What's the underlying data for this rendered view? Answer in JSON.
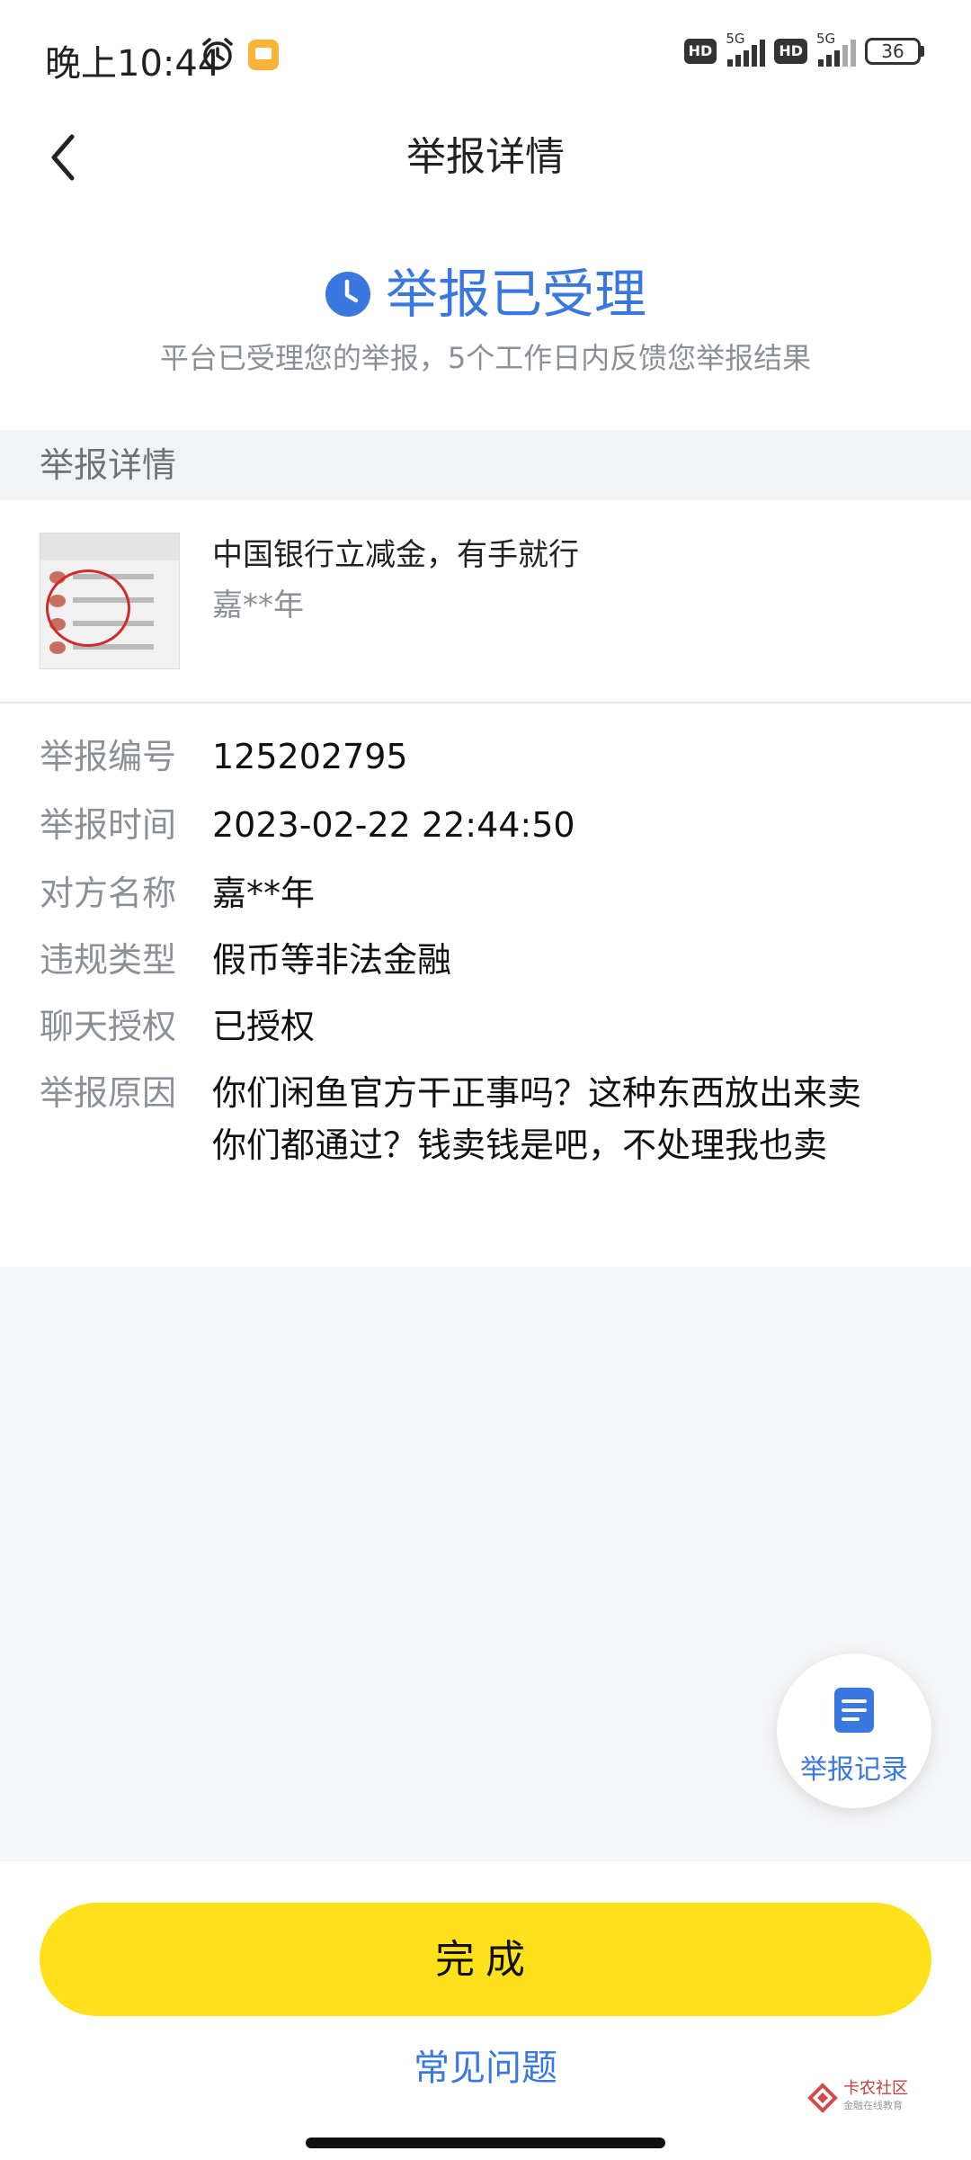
{
  "status_bar": {
    "time": "晚上10:44",
    "hd1": "HD",
    "hd2": "HD",
    "net1": "5G",
    "net2": "5G",
    "battery": "36"
  },
  "nav": {
    "title": "举报详情"
  },
  "status": {
    "headline": "举报已受理",
    "description": "平台已受理您的举报，5个工作日内反馈您举报结果",
    "accent": "#3a78e0"
  },
  "section": {
    "title": "举报详情"
  },
  "product": {
    "title": "中国银行立减金，有手就行",
    "seller": "嘉**年"
  },
  "details": [
    {
      "label": "举报编号",
      "value": "125202795"
    },
    {
      "label": "举报时间",
      "value": "2023-02-22 22:44:50"
    },
    {
      "label": "对方名称",
      "value": "嘉**年"
    },
    {
      "label": "违规类型",
      "value": "假币等非法金融"
    },
    {
      "label": "聊天授权",
      "value": "已授权"
    },
    {
      "label": "举报原因",
      "value": "你们闲鱼官方干正事吗？这种东西放出来卖你们都通过？钱卖钱是吧，不处理我也卖"
    }
  ],
  "float_button": {
    "label": "举报记录"
  },
  "bottom": {
    "done_label": "完成",
    "faq_label": "常见问题",
    "button_color": "#ffe11b"
  },
  "watermark": {
    "name": "卡农社区",
    "sub": "金融在线教育"
  }
}
